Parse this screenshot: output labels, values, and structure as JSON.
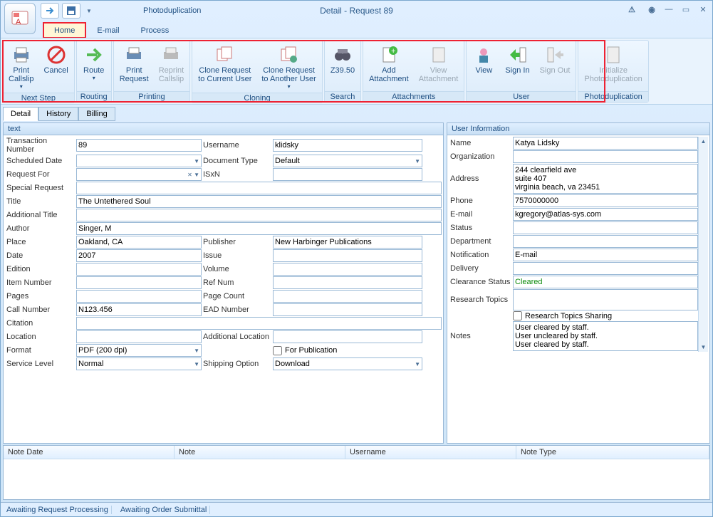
{
  "window": {
    "title": "Detail - Request 89",
    "context_tab": "Photoduplication"
  },
  "menu": {
    "home": "Home",
    "email": "E-mail",
    "process": "Process"
  },
  "ribbon": {
    "next_step": {
      "caption": "Next Step",
      "print_callslip": "Print\nCallslip",
      "cancel": "Cancel"
    },
    "routing": {
      "caption": "Routing",
      "route": "Route"
    },
    "printing": {
      "caption": "Printing",
      "print_request": "Print\nRequest",
      "reprint_callslip": "Reprint\nCallslip"
    },
    "cloning": {
      "caption": "Cloning",
      "clone_current": "Clone Request\nto Current User",
      "clone_another": "Clone Request\nto Another User"
    },
    "search": {
      "caption": "Search",
      "z3950": "Z39.50"
    },
    "attachments": {
      "caption": "Attachments",
      "add": "Add\nAttachment",
      "view": "View\nAttachment"
    },
    "user": {
      "caption": "User",
      "view": "View",
      "sign_in": "Sign In",
      "sign_out": "Sign Out"
    },
    "photoduplication": {
      "caption": "Photoduplication",
      "initialize": "Initialize\nPhotoduplication"
    }
  },
  "subtabs": {
    "detail": "Detail",
    "history": "History",
    "billing": "Billing"
  },
  "text_panel": {
    "header": "text",
    "labels": {
      "transaction_number": "Transaction Number",
      "username": "Username",
      "scheduled_date": "Scheduled Date",
      "document_type": "Document Type",
      "request_for": "Request For",
      "isxn": "ISxN",
      "special_request": "Special Request",
      "title": "Title",
      "additional_title": "Additional Title",
      "author": "Author",
      "place": "Place",
      "publisher": "Publisher",
      "date": "Date",
      "issue": "Issue",
      "edition": "Edition",
      "volume": "Volume",
      "item_number": "Item Number",
      "ref_num": "Ref Num",
      "pages": "Pages",
      "page_count": "Page Count",
      "call_number": "Call Number",
      "ead_number": "EAD Number",
      "citation": "Citation",
      "location": "Location",
      "additional_location": "Additional Location",
      "format": "Format",
      "for_publication": "For Publication",
      "service_level": "Service Level",
      "shipping_option": "Shipping Option"
    },
    "values": {
      "transaction_number": "89",
      "username": "klidsky",
      "scheduled_date": "",
      "document_type": "Default",
      "request_for": "",
      "isxn": "",
      "special_request": "",
      "title": "The Untethered Soul",
      "additional_title": "",
      "author": "Singer, M",
      "place": "Oakland, CA",
      "publisher": "New Harbinger Publications",
      "date": "2007",
      "issue": "",
      "edition": "",
      "volume": "",
      "item_number": "",
      "ref_num": "",
      "pages": "",
      "page_count": "",
      "call_number": "N123.456",
      "ead_number": "",
      "citation": "",
      "location": "",
      "additional_location": "",
      "format": "PDF (200 dpi)",
      "service_level": "Normal",
      "shipping_option": "Download"
    }
  },
  "user_panel": {
    "header": "User Information",
    "labels": {
      "name": "Name",
      "organization": "Organization",
      "address": "Address",
      "phone": "Phone",
      "email": "E-mail",
      "status": "Status",
      "department": "Department",
      "notification": "Notification",
      "delivery": "Delivery",
      "clearance": "Clearance Status",
      "research_topics": "Research Topics",
      "rt_sharing": "Research Topics Sharing",
      "notes": "Notes"
    },
    "values": {
      "name": "Katya Lidsky",
      "organization": "",
      "address": "244 clearfield ave\nsuite 407\nvirginia beach, va 23451",
      "phone": "7570000000",
      "email": "kgregory@atlas-sys.com",
      "status": "",
      "department": "",
      "notification": "E-mail",
      "delivery": "",
      "clearance": "Cleared",
      "research_topics": "",
      "notes": "User cleared by staff.\nUser uncleared by staff.\nUser cleared by staff."
    }
  },
  "notes_grid": {
    "cols": [
      "Note Date",
      "Note",
      "Username",
      "Note Type"
    ]
  },
  "status": {
    "s1": "Awaiting Request Processing",
    "s2": "Awaiting Order Submittal"
  }
}
